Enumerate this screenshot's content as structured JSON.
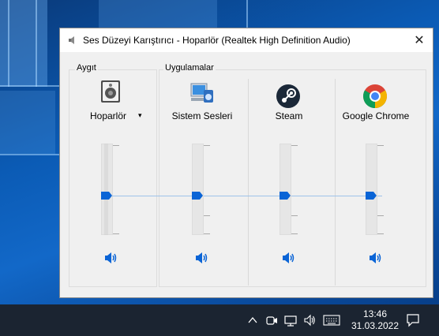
{
  "window": {
    "title": "Ses Düzeyi Karıştırıcı - Hoparlör (Realtek High Definition Audio)",
    "close_glyph": "✕"
  },
  "device_group": {
    "label": "Aygıt",
    "device": {
      "name": "Hoparlör",
      "icon": "speaker-device-icon",
      "volume_percent": 50,
      "dropdown_glyph": "▾"
    }
  },
  "apps_group": {
    "label": "Uygulamalar",
    "apps": [
      {
        "name": "Sistem Sesleri",
        "icon": "system-sounds-icon",
        "volume_percent": 50
      },
      {
        "name": "Steam",
        "icon": "steam-icon",
        "volume_percent": 50
      },
      {
        "name": "Google Chrome",
        "icon": "chrome-icon",
        "volume_percent": 50
      }
    ]
  },
  "colors": {
    "accent": "#0a64d6",
    "taskbar": "#1b2431",
    "chrome_red": "#db4437",
    "chrome_green": "#0f9d58",
    "chrome_yellow": "#f4b400",
    "chrome_blue": "#4285f4",
    "steam": "#1b2838"
  },
  "taskbar": {
    "time": "13:46",
    "date": "31.03.2022",
    "tray_icons": [
      "chevron-up-icon",
      "meet-now-icon",
      "network-icon",
      "volume-icon",
      "keyboard-icon",
      "notification-icon"
    ]
  }
}
